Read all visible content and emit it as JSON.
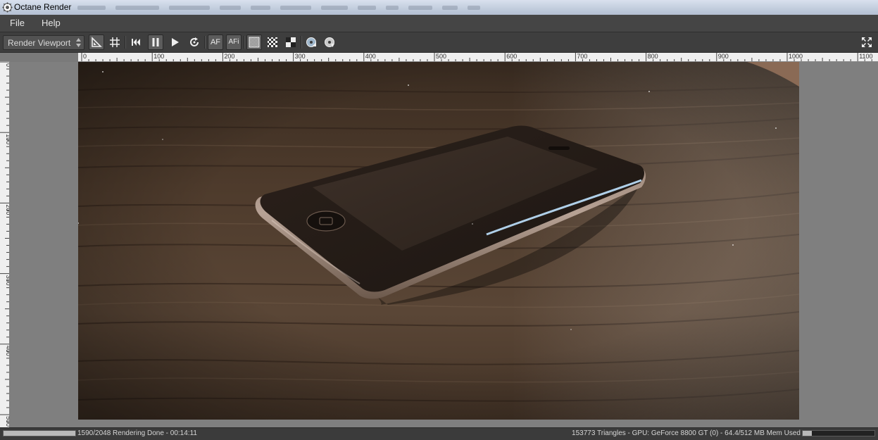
{
  "window": {
    "title": "Octane Render"
  },
  "menubar": {
    "items": [
      {
        "label": "File"
      },
      {
        "label": "Help"
      }
    ]
  },
  "toolbar": {
    "viewport_select": {
      "value": "Render Viewport"
    },
    "buttons": [
      {
        "name": "ruler-toggle-button",
        "icon": "set-square-icon",
        "active": true
      },
      {
        "name": "grid-toggle-button",
        "icon": "grid-icon",
        "active": false
      },
      {
        "name": "restart-render-button",
        "icon": "skip-back-icon",
        "active": false
      },
      {
        "name": "pause-render-button",
        "icon": "pause-icon",
        "active": true
      },
      {
        "name": "start-render-button",
        "icon": "play-icon",
        "active": false
      },
      {
        "name": "refresh-button",
        "icon": "refresh-icon",
        "active": false
      },
      {
        "name": "autofocus-button",
        "icon": "autofocus-icon",
        "label": "AF",
        "active": true
      },
      {
        "name": "autofocus-picker-button",
        "icon": "autofocus-picker-icon",
        "label": "AFi",
        "active": true
      },
      {
        "name": "preview-mode-button",
        "icon": "checker-fine-icon",
        "active": true
      },
      {
        "name": "alpha-checker-button",
        "icon": "checker-icon",
        "active": false
      },
      {
        "name": "checker-large-button",
        "icon": "checker-large-icon",
        "active": false
      },
      {
        "name": "load-image-button",
        "icon": "disc-icon",
        "active": false
      },
      {
        "name": "save-image-button",
        "icon": "disc-save-icon",
        "active": false
      }
    ],
    "fullscreen_button": {
      "icon": "fullscreen-icon"
    }
  },
  "rulers": {
    "horizontal": [
      "0",
      "100",
      "200",
      "300",
      "400",
      "500",
      "600",
      "700",
      "800",
      "900",
      "1000",
      "1100"
    ],
    "vertical": [
      "0",
      "100",
      "200",
      "300",
      "400",
      "500"
    ]
  },
  "render": {
    "description_icon": "rendered-iphone-image"
  },
  "status": {
    "left_text": "1590/2048 Rendering Done - 00:14:11",
    "right_text": "153773 Triangles - GPU: GeForce 8800 GT (0) - 64.4/512 MB Mem Used",
    "render_progress": 1.0,
    "memory_usage": 0.126
  }
}
